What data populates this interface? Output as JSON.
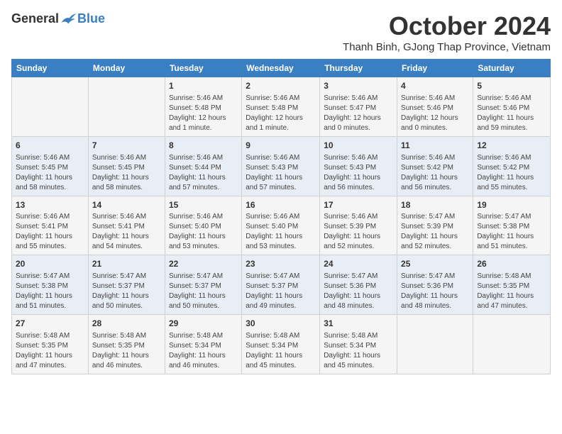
{
  "header": {
    "logo_general": "General",
    "logo_blue": "Blue",
    "month_title": "October 2024",
    "subtitle": "Thanh Binh, GJong Thap Province, Vietnam"
  },
  "days_of_week": [
    "Sunday",
    "Monday",
    "Tuesday",
    "Wednesday",
    "Thursday",
    "Friday",
    "Saturday"
  ],
  "weeks": [
    [
      {
        "day": "",
        "info": ""
      },
      {
        "day": "",
        "info": ""
      },
      {
        "day": "1",
        "info": "Sunrise: 5:46 AM\nSunset: 5:48 PM\nDaylight: 12 hours\nand 1 minute."
      },
      {
        "day": "2",
        "info": "Sunrise: 5:46 AM\nSunset: 5:48 PM\nDaylight: 12 hours\nand 1 minute."
      },
      {
        "day": "3",
        "info": "Sunrise: 5:46 AM\nSunset: 5:47 PM\nDaylight: 12 hours\nand 0 minutes."
      },
      {
        "day": "4",
        "info": "Sunrise: 5:46 AM\nSunset: 5:46 PM\nDaylight: 12 hours\nand 0 minutes."
      },
      {
        "day": "5",
        "info": "Sunrise: 5:46 AM\nSunset: 5:46 PM\nDaylight: 11 hours\nand 59 minutes."
      }
    ],
    [
      {
        "day": "6",
        "info": "Sunrise: 5:46 AM\nSunset: 5:45 PM\nDaylight: 11 hours\nand 58 minutes."
      },
      {
        "day": "7",
        "info": "Sunrise: 5:46 AM\nSunset: 5:45 PM\nDaylight: 11 hours\nand 58 minutes."
      },
      {
        "day": "8",
        "info": "Sunrise: 5:46 AM\nSunset: 5:44 PM\nDaylight: 11 hours\nand 57 minutes."
      },
      {
        "day": "9",
        "info": "Sunrise: 5:46 AM\nSunset: 5:43 PM\nDaylight: 11 hours\nand 57 minutes."
      },
      {
        "day": "10",
        "info": "Sunrise: 5:46 AM\nSunset: 5:43 PM\nDaylight: 11 hours\nand 56 minutes."
      },
      {
        "day": "11",
        "info": "Sunrise: 5:46 AM\nSunset: 5:42 PM\nDaylight: 11 hours\nand 56 minutes."
      },
      {
        "day": "12",
        "info": "Sunrise: 5:46 AM\nSunset: 5:42 PM\nDaylight: 11 hours\nand 55 minutes."
      }
    ],
    [
      {
        "day": "13",
        "info": "Sunrise: 5:46 AM\nSunset: 5:41 PM\nDaylight: 11 hours\nand 55 minutes."
      },
      {
        "day": "14",
        "info": "Sunrise: 5:46 AM\nSunset: 5:41 PM\nDaylight: 11 hours\nand 54 minutes."
      },
      {
        "day": "15",
        "info": "Sunrise: 5:46 AM\nSunset: 5:40 PM\nDaylight: 11 hours\nand 53 minutes."
      },
      {
        "day": "16",
        "info": "Sunrise: 5:46 AM\nSunset: 5:40 PM\nDaylight: 11 hours\nand 53 minutes."
      },
      {
        "day": "17",
        "info": "Sunrise: 5:46 AM\nSunset: 5:39 PM\nDaylight: 11 hours\nand 52 minutes."
      },
      {
        "day": "18",
        "info": "Sunrise: 5:47 AM\nSunset: 5:39 PM\nDaylight: 11 hours\nand 52 minutes."
      },
      {
        "day": "19",
        "info": "Sunrise: 5:47 AM\nSunset: 5:38 PM\nDaylight: 11 hours\nand 51 minutes."
      }
    ],
    [
      {
        "day": "20",
        "info": "Sunrise: 5:47 AM\nSunset: 5:38 PM\nDaylight: 11 hours\nand 51 minutes."
      },
      {
        "day": "21",
        "info": "Sunrise: 5:47 AM\nSunset: 5:37 PM\nDaylight: 11 hours\nand 50 minutes."
      },
      {
        "day": "22",
        "info": "Sunrise: 5:47 AM\nSunset: 5:37 PM\nDaylight: 11 hours\nand 50 minutes."
      },
      {
        "day": "23",
        "info": "Sunrise: 5:47 AM\nSunset: 5:37 PM\nDaylight: 11 hours\nand 49 minutes."
      },
      {
        "day": "24",
        "info": "Sunrise: 5:47 AM\nSunset: 5:36 PM\nDaylight: 11 hours\nand 48 minutes."
      },
      {
        "day": "25",
        "info": "Sunrise: 5:47 AM\nSunset: 5:36 PM\nDaylight: 11 hours\nand 48 minutes."
      },
      {
        "day": "26",
        "info": "Sunrise: 5:48 AM\nSunset: 5:35 PM\nDaylight: 11 hours\nand 47 minutes."
      }
    ],
    [
      {
        "day": "27",
        "info": "Sunrise: 5:48 AM\nSunset: 5:35 PM\nDaylight: 11 hours\nand 47 minutes."
      },
      {
        "day": "28",
        "info": "Sunrise: 5:48 AM\nSunset: 5:35 PM\nDaylight: 11 hours\nand 46 minutes."
      },
      {
        "day": "29",
        "info": "Sunrise: 5:48 AM\nSunset: 5:34 PM\nDaylight: 11 hours\nand 46 minutes."
      },
      {
        "day": "30",
        "info": "Sunrise: 5:48 AM\nSunset: 5:34 PM\nDaylight: 11 hours\nand 45 minutes."
      },
      {
        "day": "31",
        "info": "Sunrise: 5:48 AM\nSunset: 5:34 PM\nDaylight: 11 hours\nand 45 minutes."
      },
      {
        "day": "",
        "info": ""
      },
      {
        "day": "",
        "info": ""
      }
    ]
  ]
}
